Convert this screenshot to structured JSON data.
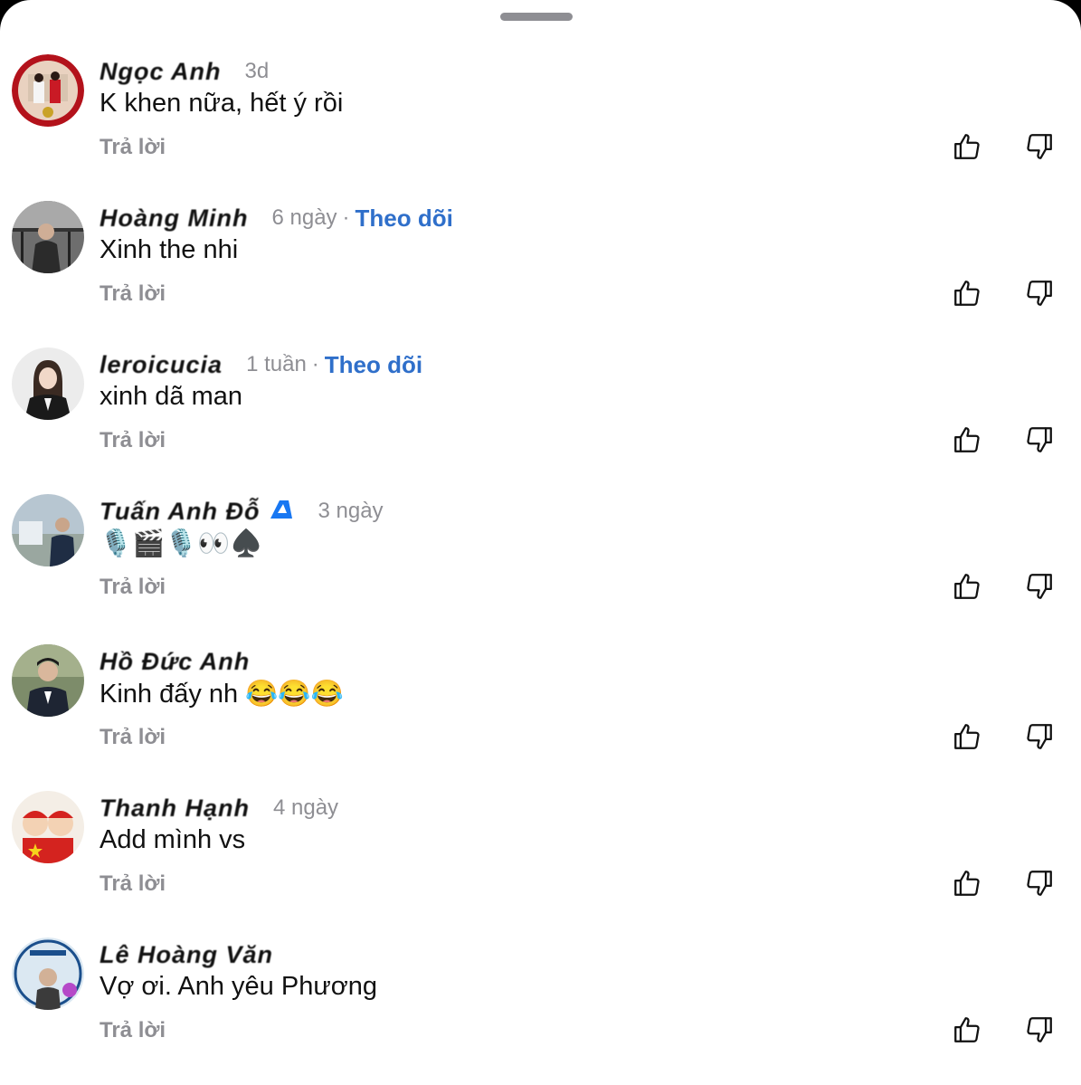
{
  "sheet": {
    "handle": "drag-handle"
  },
  "reply_label": "Trả lời",
  "follow_label": "Theo dõi",
  "comments": [
    {
      "author": "Ngọc Anh",
      "meta": "3d",
      "text": "K khen nữa, hết ý rồi",
      "follow": ""
    },
    {
      "author": "Hoàng Minh",
      "meta": "6 ngày",
      "text": "Xinh the nhi",
      "follow": "Theo dõi"
    },
    {
      "author": "leroicucia",
      "meta": "1 tuần",
      "text": "xinh dã man",
      "follow": "Theo dõi"
    },
    {
      "author": "Tuấn Anh Đỗ",
      "meta": "3 ngày",
      "text": "🎙️🎬🎙️👀♠️",
      "follow": ""
    },
    {
      "author": "Hồ Đức Anh",
      "meta": "",
      "text": "Kinh đấy nh 😂😂😂",
      "follow": ""
    },
    {
      "author": "Thanh Hạnh",
      "meta": "4 ngày",
      "text": "Add mình vs",
      "follow": ""
    },
    {
      "author": "Lê Hoàng Văn",
      "meta": "",
      "text": "Vợ ơi. Anh yêu Phương",
      "follow": ""
    }
  ],
  "icons": {
    "like": "thumbs-up-icon",
    "dislike": "thumbs-down-icon"
  },
  "colors": {
    "follow": "#2f6fca",
    "muted": "#8e8e93",
    "text": "#111111",
    "verified": "#1877f2"
  }
}
